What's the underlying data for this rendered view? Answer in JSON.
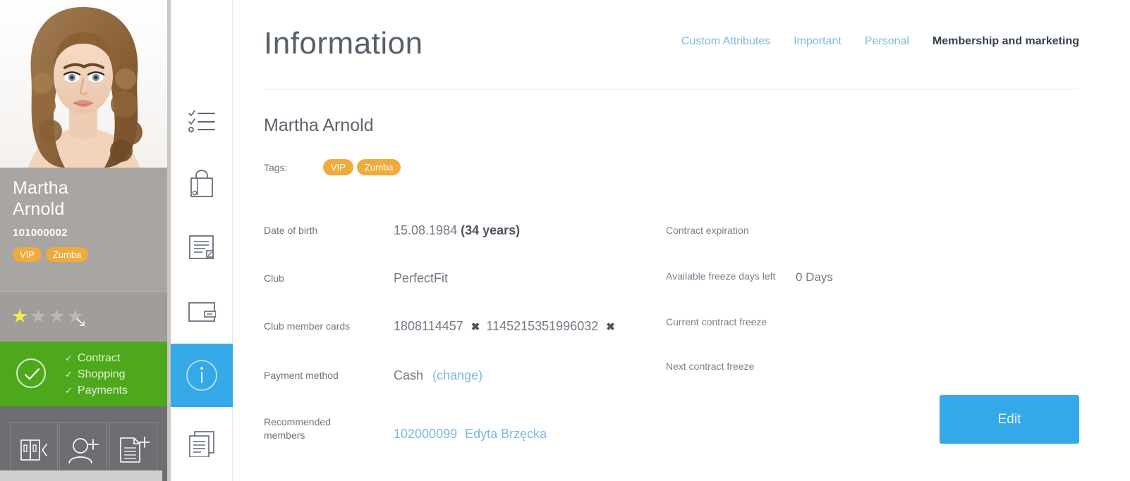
{
  "member_panel": {
    "photo_alt": "member-portrait",
    "name": "Martha\nArnold",
    "name_line1": "Martha",
    "name_line2": "Arnold",
    "member_number": "101000002",
    "tags": [
      "VIP",
      "Zumba"
    ],
    "rating": {
      "value": 1,
      "max": 5,
      "expand_icon": "arrow-down-right-icon"
    },
    "status": {
      "icon": "check-circle-icon",
      "items": [
        "Contract",
        "Shopping",
        "Payments"
      ]
    },
    "actions": [
      {
        "name": "lockers-icon",
        "label": "Lockers"
      },
      {
        "name": "add-member-icon",
        "label": "Add member"
      },
      {
        "name": "add-document-icon",
        "label": "Add document"
      }
    ]
  },
  "icon_rail": {
    "items": [
      {
        "name": "checklist-icon",
        "label": "Tasks",
        "active": false
      },
      {
        "name": "shopping-bag-icon",
        "label": "Shopping",
        "active": false
      },
      {
        "name": "contract-icon",
        "label": "Contracts",
        "active": false
      },
      {
        "name": "payment-card-icon",
        "label": "Payments",
        "active": false
      },
      {
        "name": "info-icon",
        "label": "Information",
        "active": true
      },
      {
        "name": "documents-icon",
        "label": "Documents",
        "active": false
      }
    ]
  },
  "header": {
    "title": "Information",
    "tabs": [
      {
        "label": "Custom Attributes",
        "active": false
      },
      {
        "label": "Important",
        "active": false
      },
      {
        "label": "Personal",
        "active": false
      },
      {
        "label": "Membership and marketing",
        "active": true
      }
    ]
  },
  "content": {
    "member_name": "Martha Arnold",
    "tags_label": "Tags:",
    "tags": [
      "VIP",
      "Zumba"
    ],
    "left_fields": [
      {
        "label": "Date of birth",
        "value": "15.08.1984",
        "emphasis": "(34 years)"
      },
      {
        "label": "Club",
        "value": "PerfectFit"
      },
      {
        "label": "Club member cards",
        "cards": [
          "1808114457",
          "1145215351996032"
        ],
        "remove_symbol": "✖"
      },
      {
        "label": "Payment method",
        "value": "Cash",
        "link": "(change)"
      },
      {
        "label": "Recommended members",
        "label_line1": "Recommended",
        "label_line2": "members",
        "link_number": "102000099",
        "link_name": "Edyta Brzęcka"
      }
    ],
    "right_fields": [
      {
        "label": "Contract expiration",
        "value": ""
      },
      {
        "label": "Available freeze days left",
        "value": "0 Days"
      },
      {
        "label": "Current contract freeze",
        "value": ""
      },
      {
        "label": "Next contract freeze",
        "value": ""
      }
    ],
    "edit_button": "Edit"
  },
  "colors": {
    "accent_blue": "#35a8e8",
    "tag_orange": "#efab3c",
    "status_green": "#4ea81c",
    "panel_gray": "#a8a5a2",
    "link_blue": "#7fb8dd",
    "star_yellow": "#f3ec4a"
  }
}
